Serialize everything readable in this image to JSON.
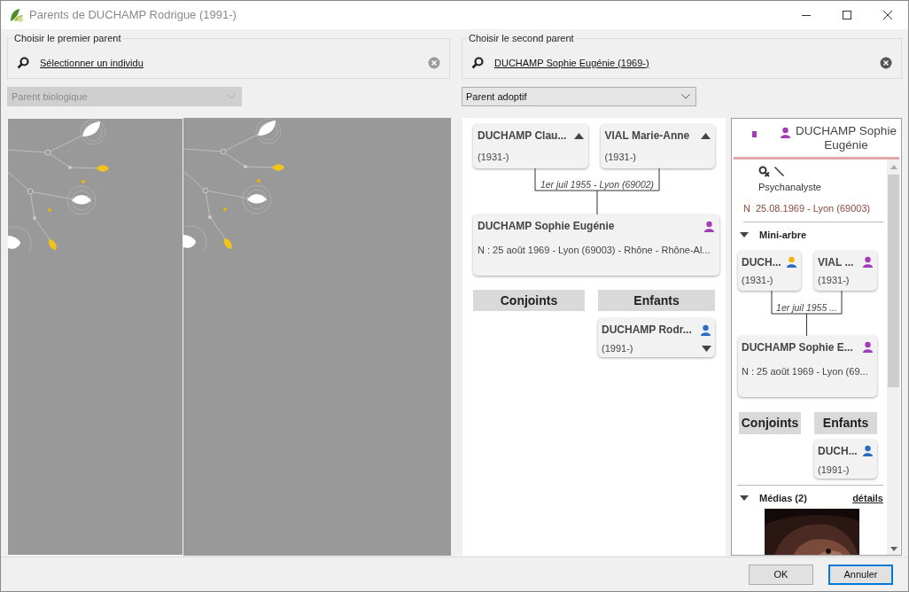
{
  "window": {
    "title": "Parents de DUCHAMP Rodrigue (1991-)"
  },
  "first_parent": {
    "legend": "Choisir le premier parent",
    "value": "Sélectionner un individu",
    "relation": {
      "value": "Parent biologique",
      "disabled": true
    }
  },
  "second_parent": {
    "legend": "Choisir le second parent",
    "value": "DUCHAMP Sophie Eugénie (1969-)",
    "relation": {
      "value": "Parent adoptif",
      "disabled": false
    }
  },
  "tree": {
    "parents": [
      {
        "name": "DUCHAMP Clau...",
        "dates": "(1931-)"
      },
      {
        "name": "VIAL Marie-Anne",
        "dates": "(1931-)"
      }
    ],
    "union": "1er juil 1955 - Lyon (69002)",
    "person": {
      "name": "DUCHAMP Sophie Eugénie",
      "birth": "N : 25 août 1969 - Lyon (69003) - Rhône - Rhône-Al...",
      "color": "#a43bb8"
    },
    "spouses_label": "Conjoints",
    "children_label": "Enfants",
    "children": [
      {
        "name": "DUCHAMP Rodr...",
        "dates": "(1991-)",
        "color": "#2a6cc8"
      }
    ]
  },
  "side_panel": {
    "name": "DUCHAMP Sophie Eugénie",
    "color": "#a43bb8",
    "occupation": "Psychanalyste",
    "birth_marker": "N",
    "birth": "25.08.1969 - Lyon (69003)",
    "mini_tree": {
      "title": "Mini-arbre",
      "expanded": true,
      "parents": [
        {
          "name": "DUCH...",
          "dates": "(1931-)",
          "color": "#2a6cc8",
          "highlighted": true
        },
        {
          "name": "VIAL ...",
          "dates": "(1931-)",
          "color": "#a43bb8",
          "highlighted": false
        }
      ],
      "union": "1er juil 1955 ...",
      "person": {
        "name": "DUCHAMP Sophie E...",
        "birth": "N : 25 août 1969 - Lyon (69...",
        "color": "#a43bb8"
      },
      "spouses_label": "Conjoints",
      "children_label": "Enfants",
      "children": [
        {
          "name": "DUCH...",
          "dates": "(1991-)",
          "color": "#2a6cc8"
        }
      ]
    },
    "media": {
      "title": "Médias (2)",
      "expanded": true,
      "link": "détails"
    }
  },
  "buttons": [
    {
      "label": "OK",
      "default": false
    },
    {
      "label": "Annuler",
      "default": true
    }
  ]
}
